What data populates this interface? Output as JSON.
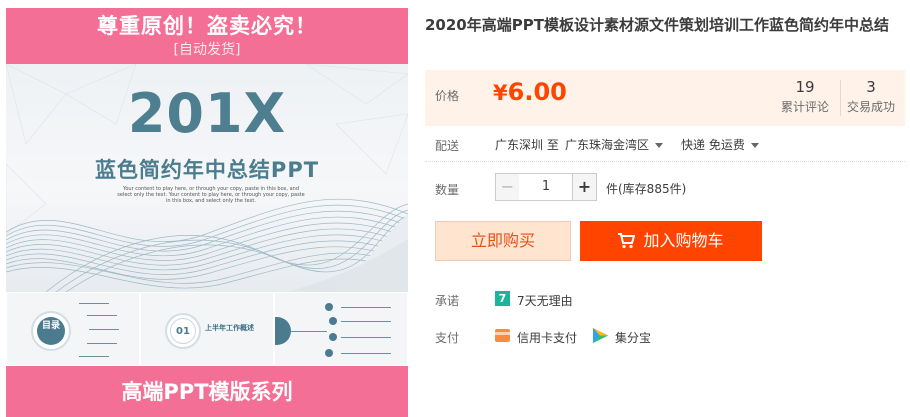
{
  "gallery": {
    "banner_top": "尊重原创！盗卖必究！",
    "banner_top_sub": "[自动发货]",
    "hero_title": "201X",
    "hero_subtitle": "蓝色简约年中总结PPT",
    "hero_desc": "Your content to play here, or through your copy, paste in this box, and select only the text. Your content to play here, or through your copy, paste in this box, and select only the text.",
    "thumb1_label": "目录",
    "thumb2_num": "01",
    "thumb2_label": "上半年工作概述",
    "banner_bottom": "高端PPT模版系列"
  },
  "product": {
    "title": "2020年高端PPT模板设计素材源文件策划培训工作蓝色简约年中总结"
  },
  "price": {
    "label": "价格",
    "currency": "¥",
    "value": "6.00",
    "reviews_count": "19",
    "reviews_label": "累计评论",
    "sales_count": "3",
    "sales_label": "交易成功"
  },
  "shipping": {
    "label": "配送",
    "origin": "广东深圳 至",
    "destination": "广东珠海金湾区",
    "method": "快递 免运费"
  },
  "quantity": {
    "label": "数量",
    "minus": "−",
    "value": "1",
    "plus": "+",
    "stock": "件(库存885件)"
  },
  "actions": {
    "buy_now": "立即购买",
    "add_to_cart": "加入购物车"
  },
  "promise": {
    "label": "承诺",
    "badge": "7",
    "text": "7天无理由"
  },
  "payment": {
    "label": "支付",
    "method1": "信用卡支付",
    "method2": "集分宝"
  },
  "colors": {
    "accent": "#ff4400",
    "price": "#ff4400",
    "banner_pink": "#f46f95",
    "price_bg": "#fff2e8",
    "hero_teal": "#4d7f91"
  }
}
